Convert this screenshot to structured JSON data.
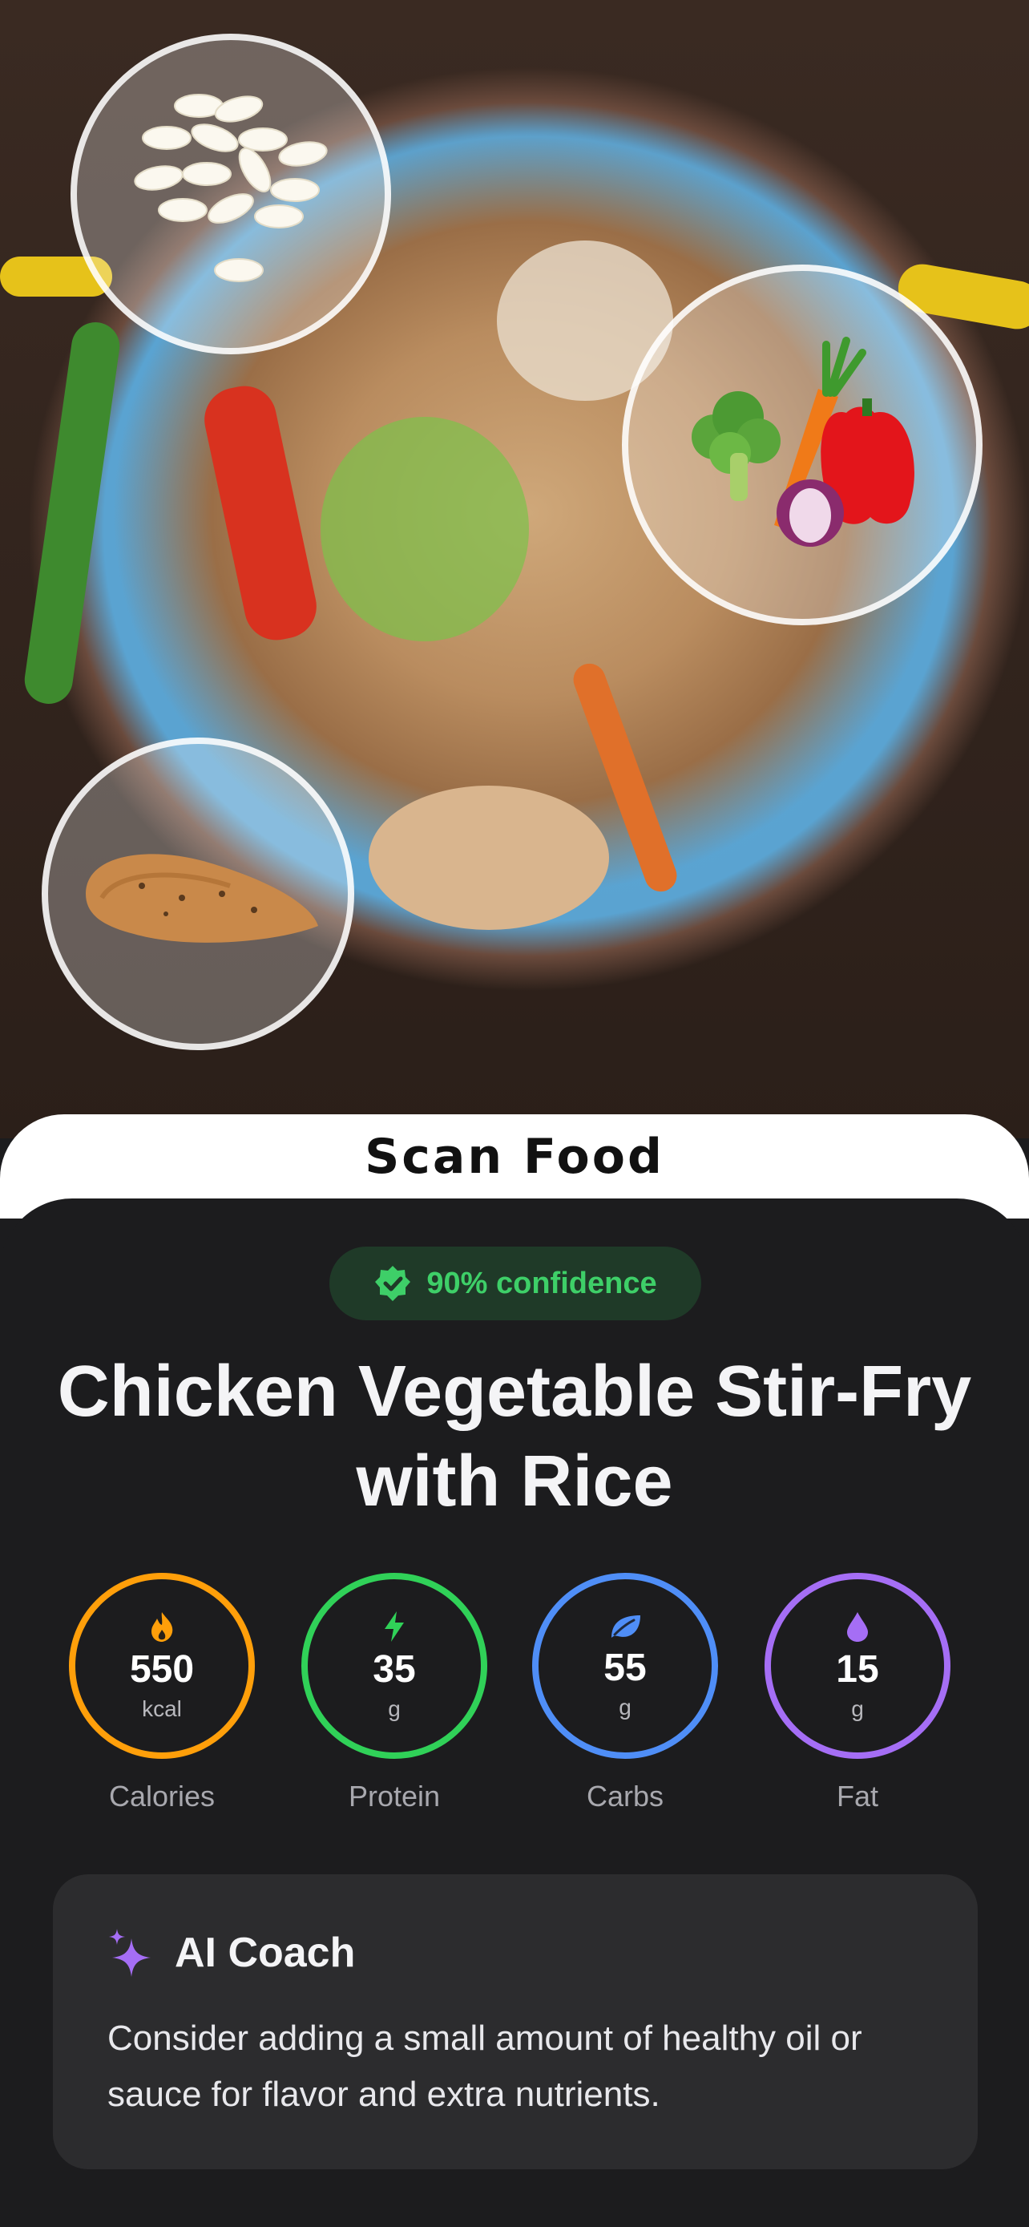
{
  "header": {
    "title": "Scan Food"
  },
  "result": {
    "confidence_label": "90% confidence",
    "food_name": "Chicken Vegetable Stir-Fry with Rice"
  },
  "macros": [
    {
      "value": "550",
      "unit": "kcal",
      "label": "Calories",
      "icon": "flame-icon",
      "color": "#ff9f0a"
    },
    {
      "value": "35",
      "unit": "g",
      "label": "Protein",
      "icon": "bolt-icon",
      "color": "#30d158"
    },
    {
      "value": "55",
      "unit": "g",
      "label": "Carbs",
      "icon": "leaf-icon",
      "color": "#4f8ef7"
    },
    {
      "value": "15",
      "unit": "g",
      "label": "Fat",
      "icon": "drop-icon",
      "color": "#a56ef5"
    }
  ],
  "coach": {
    "title": "AI Coach",
    "message": "Consider adding a small amount of healthy oil or sauce for flavor and extra nutrients."
  },
  "ingredient_bubbles": [
    "rice-icon",
    "vegetables-icon",
    "chicken-icon"
  ]
}
